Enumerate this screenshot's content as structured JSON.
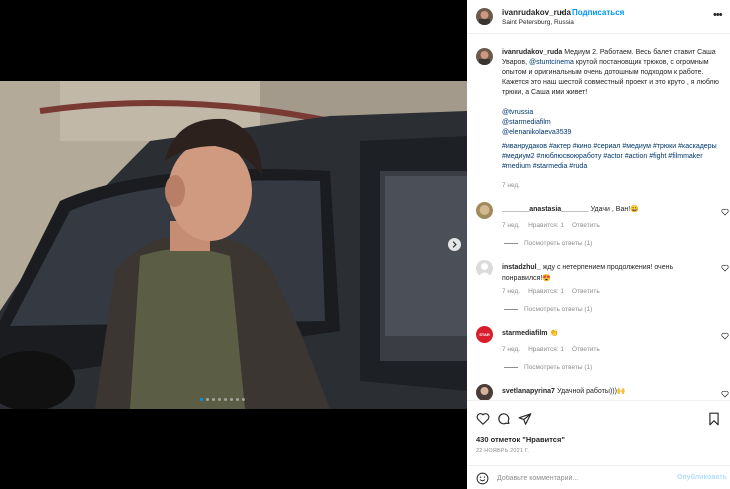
{
  "media": {
    "slide_count": 8,
    "active_slide": 1,
    "next_icon": "chevron-right-icon"
  },
  "post": {
    "username": "ivanrudakov_ruda",
    "separator": "•",
    "follow_label": "Подписаться",
    "location": "Saint Petersburg, Russia",
    "more_icon": "more-horizontal-icon",
    "caption": {
      "username": "ivanrudakov_ruda",
      "text": "Медиум 2. Работаем. Весь балет ставит Саша Уваров,",
      "mention_stunt": "@stuntcinema",
      "text2": "крутой постановщик трюков, с огромным опытом и оригинальным очень дотошным подходом к работе. Кажется это наш шестой совместный проект и это круто , я люблю трюки, а Саша ими живет!",
      "mentions": [
        "@tvrussia",
        "@starmediafilm",
        "@elenanikolaeva3539"
      ],
      "hashtags": "#иванрудаков #актер #кино #сериал #медиум #трюки #каскадеры #медиум2 #люблюсвоюработу #actor #action #fight #filmmaker #medium #starmedia #ruda",
      "time": "7 нед."
    },
    "comments": [
      {
        "username": "_______anastasia_______",
        "text": "Удачи , Ван!😀",
        "time": "7 нед.",
        "likes": "Нравится: 1",
        "reply": "Ответить",
        "view_replies": "Посмотреть ответы (1)"
      },
      {
        "username": "instadzhul_",
        "text": "жду с нетерпением продолжения! очень понравился!😍",
        "time": "7 нед.",
        "likes": "Нравится: 1",
        "reply": "Ответить",
        "view_replies": "Посмотреть ответы (1)"
      },
      {
        "username": "starmediafilm",
        "text": "👏",
        "time": "7 нед.",
        "likes": "Нравится: 1",
        "reply": "Ответить",
        "view_replies": "Посмотреть ответы (1)",
        "avatar_text": "STAR",
        "avatar_color": "#d81e2c"
      },
      {
        "username": "svetlanapyrina7",
        "text": "Удачной работы)))🙌",
        "time": "",
        "likes": "",
        "reply": "",
        "view_replies": ""
      }
    ],
    "likes_text": "430 отметок \"Нравится\"",
    "date": "22 НОЯБРЬ 2021 Г.",
    "comment_placeholder": "Добавьте комментарий...",
    "publish_label": "Опубликовать",
    "icons": [
      "heart-icon",
      "comment-icon",
      "share-icon",
      "bookmark-icon",
      "emoji-icon"
    ]
  },
  "colors": {
    "link": "#0095f6",
    "hashtag": "#00376b",
    "muted": "#8e8e8e",
    "publish_disabled": "#b2dffc"
  }
}
